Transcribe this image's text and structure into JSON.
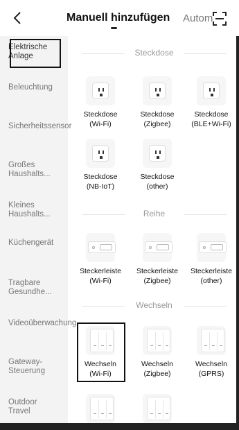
{
  "header": {
    "back_icon": "chevron-left-icon",
    "title": "Manuell hinzufügen",
    "second_tab": "Autom",
    "scan_icon": "scan-icon"
  },
  "sidebar": {
    "items": [
      {
        "label": "Elektrische Anlage",
        "active": true
      },
      {
        "label": "Beleuchtung"
      },
      {
        "label": "Sicherheitssensor"
      },
      {
        "label": "Großes Haushalts..."
      },
      {
        "label": "Kleines Haushalts..."
      },
      {
        "label": "Küchengerät"
      },
      {
        "label": "Tragbare Gesundhe..."
      },
      {
        "label": "Videoüberwachung"
      },
      {
        "label": "Gateway-Steuerung"
      },
      {
        "label": "Outdoor Travel"
      }
    ]
  },
  "sections": [
    {
      "title": "Steckdose",
      "devices": [
        {
          "line1": "Steckdose",
          "line2": "(Wi-Fi)",
          "icon": "socket-icon"
        },
        {
          "line1": "Steckdose",
          "line2": "(Zigbee)",
          "icon": "socket-icon"
        },
        {
          "line1": "Steckdose",
          "line2": "(BLE+Wi-Fi)",
          "icon": "socket-icon"
        },
        {
          "line1": "Steckdose",
          "line2": "(NB-IoT)",
          "icon": "socket-icon"
        },
        {
          "line1": "Steckdose",
          "line2": "(other)",
          "icon": "socket-icon"
        }
      ]
    },
    {
      "title": "Reihe",
      "devices": [
        {
          "line1": "Steckerleiste",
          "line2": "(Wi-Fi)",
          "icon": "power-strip-icon"
        },
        {
          "line1": "Steckerleiste",
          "line2": "(Zigbee)",
          "icon": "power-strip-icon"
        },
        {
          "line1": "Steckerleiste",
          "line2": "(other)",
          "icon": "power-strip-icon"
        }
      ]
    },
    {
      "title": "Wechseln",
      "devices": [
        {
          "line1": "Wechseln",
          "line2": "(Wi-Fi)",
          "icon": "wall-switch-icon",
          "selected": true
        },
        {
          "line1": "Wechseln",
          "line2": "(Zigbee)",
          "icon": "wall-switch-icon"
        },
        {
          "line1": "Wechseln",
          "line2": "(GPRS)",
          "icon": "wall-switch-icon"
        },
        {
          "line1": "",
          "line2": "",
          "icon": "wall-switch-icon"
        },
        {
          "line1": "",
          "line2": "",
          "icon": "wall-switch-icon"
        }
      ]
    }
  ]
}
